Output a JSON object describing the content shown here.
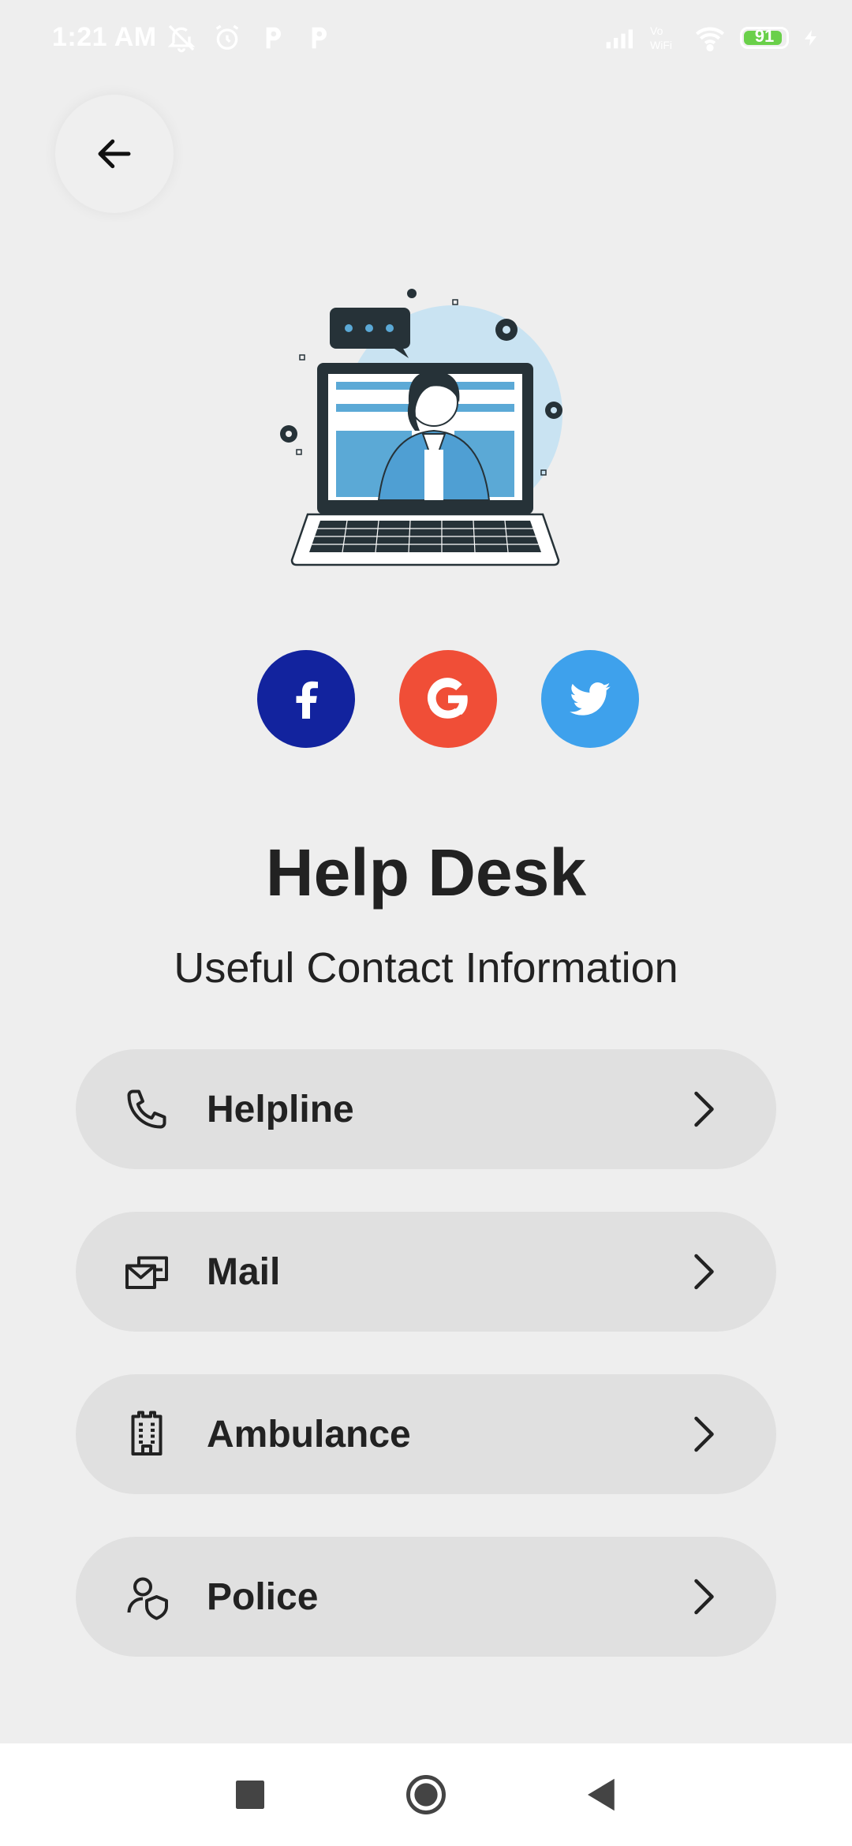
{
  "status_bar": {
    "time": "1:21 AM",
    "battery": "91",
    "battery_level": 0.91,
    "network_label": "Vo WiFi"
  },
  "header": {
    "back_icon": "arrow-left-icon"
  },
  "hero": {
    "illustration": "help-desk-agent-laptop-illustration"
  },
  "social": [
    {
      "name": "facebook",
      "icon": "facebook-icon",
      "color": "#12239e"
    },
    {
      "name": "google",
      "icon": "google-icon",
      "color": "#f04e37"
    },
    {
      "name": "twitter",
      "icon": "twitter-icon",
      "color": "#3ea1ec"
    }
  ],
  "title": "Help Desk",
  "subtitle": "Useful Contact Information",
  "menu": {
    "items": [
      {
        "label": "Helpline",
        "icon": "phone-icon"
      },
      {
        "label": "Mail",
        "icon": "mail-icon"
      },
      {
        "label": "Ambulance",
        "icon": "hospital-building-icon"
      },
      {
        "label": "Police",
        "icon": "police-shield-user-icon"
      }
    ]
  },
  "nav": {
    "recents": "square-icon",
    "home": "circle-icon",
    "back": "triangle-back-icon"
  }
}
